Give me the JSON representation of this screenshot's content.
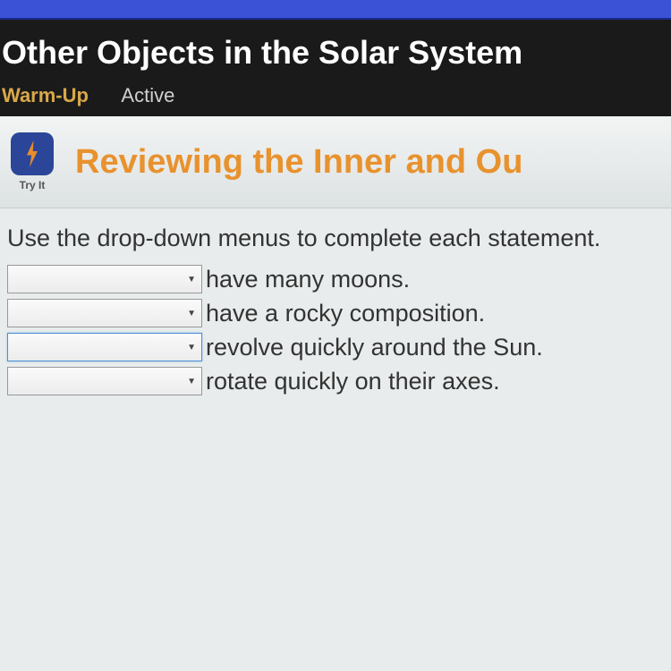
{
  "header": {
    "title": "Other Objects in the Solar System",
    "tabs": {
      "warmup": "Warm-Up",
      "active": "Active"
    }
  },
  "banner": {
    "try_it_label": "Try It",
    "title": "Reviewing the Inner and Ou"
  },
  "main": {
    "instructions": "Use the drop-down menus to complete each statement.",
    "statements": [
      {
        "text": "have many moons.",
        "focused": false
      },
      {
        "text": "have a rocky composition.",
        "focused": false
      },
      {
        "text": "revolve quickly around the Sun.",
        "focused": true
      },
      {
        "text": "rotate quickly on their axes.",
        "focused": false
      }
    ]
  }
}
